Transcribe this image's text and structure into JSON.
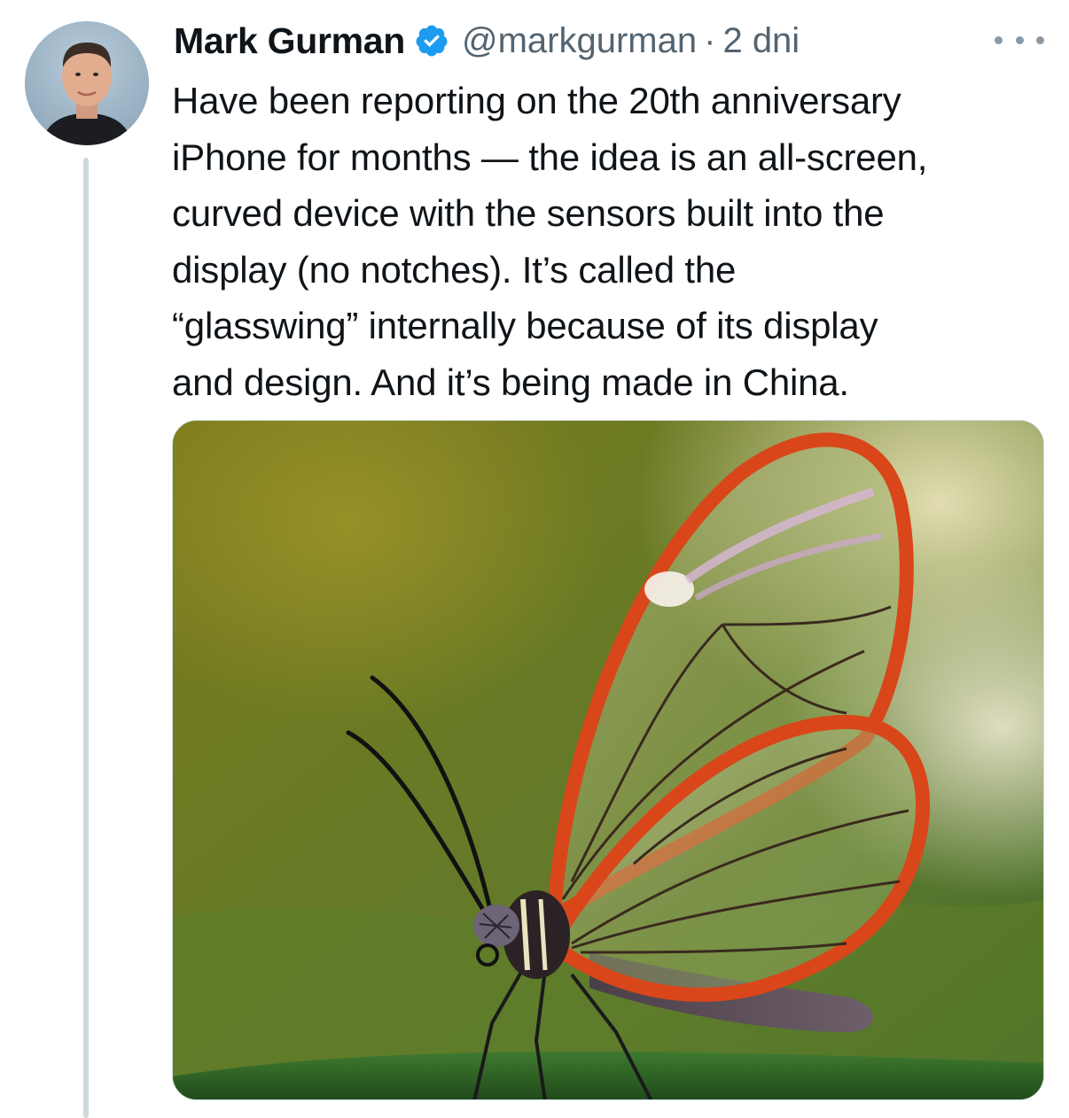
{
  "tweet": {
    "author_name": "Mark Gurman",
    "handle": "@markgurman",
    "separator": "·",
    "time": "2 dni",
    "text_lines": [
      "Have been reporting on the 20th anniversary",
      "iPhone for months — the idea is an all-screen,",
      "curved device with the sensors built into the",
      "display (no notches). It’s called the",
      "“glasswing” internally because of its display",
      "and design. And it’s being made in China."
    ],
    "verified_badge_color": "#1d9bf0",
    "more_icon": "ellipsis-icon",
    "media_subject": "glasswing-butterfly-photo"
  },
  "colors": {
    "text_primary": "#0f1419",
    "text_secondary": "#536471",
    "thread_line": "#cfd9de",
    "wing_edge": "#d9461a"
  }
}
